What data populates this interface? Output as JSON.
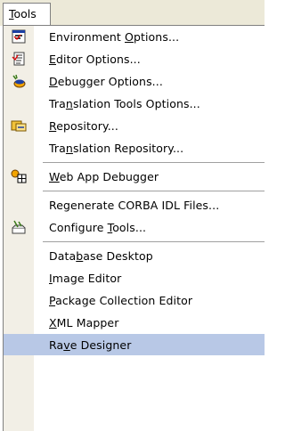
{
  "menubar": {
    "title": "Tools"
  },
  "menu": {
    "groups": [
      [
        {
          "label": "Environment Options...",
          "icon": "environment-icon"
        },
        {
          "label": "Editor Options...",
          "icon": "editor-icon"
        },
        {
          "label": "Debugger Options...",
          "icon": "debugger-icon"
        },
        {
          "label": "Translation Tools Options...",
          "icon": null
        },
        {
          "label": "Repository...",
          "icon": "repository-icon"
        },
        {
          "label": "Translation Repository...",
          "icon": null
        }
      ],
      [
        {
          "label": "Web App Debugger",
          "icon": "web-app-debugger-icon"
        }
      ],
      [
        {
          "label": "Regenerate CORBA IDL Files...",
          "icon": null
        },
        {
          "label": "Configure Tools...",
          "icon": "configure-tools-icon"
        }
      ],
      [
        {
          "label": "Database Desktop",
          "icon": null
        },
        {
          "label": "Image Editor",
          "icon": null
        },
        {
          "label": "Package Collection Editor",
          "icon": null
        },
        {
          "label": "XML Mapper",
          "icon": null
        },
        {
          "label": "Rave Designer",
          "icon": null,
          "selected": true
        }
      ]
    ],
    "mnemonics": {
      "Tools": "T",
      "Environment Options...": "O",
      "Editor Options...": "E",
      "Debugger Options...": "D",
      "Translation Tools Options...": "n",
      "Repository...": "R",
      "Translation Repository...": "n",
      "Web App Debugger": "W",
      "Regenerate CORBA IDL Files...": "",
      "Configure Tools...": "T",
      "Database Desktop": "b",
      "Image Editor": "I",
      "Package Collection Editor": "P",
      "XML Mapper": "X",
      "Rave Designer": "v"
    }
  }
}
